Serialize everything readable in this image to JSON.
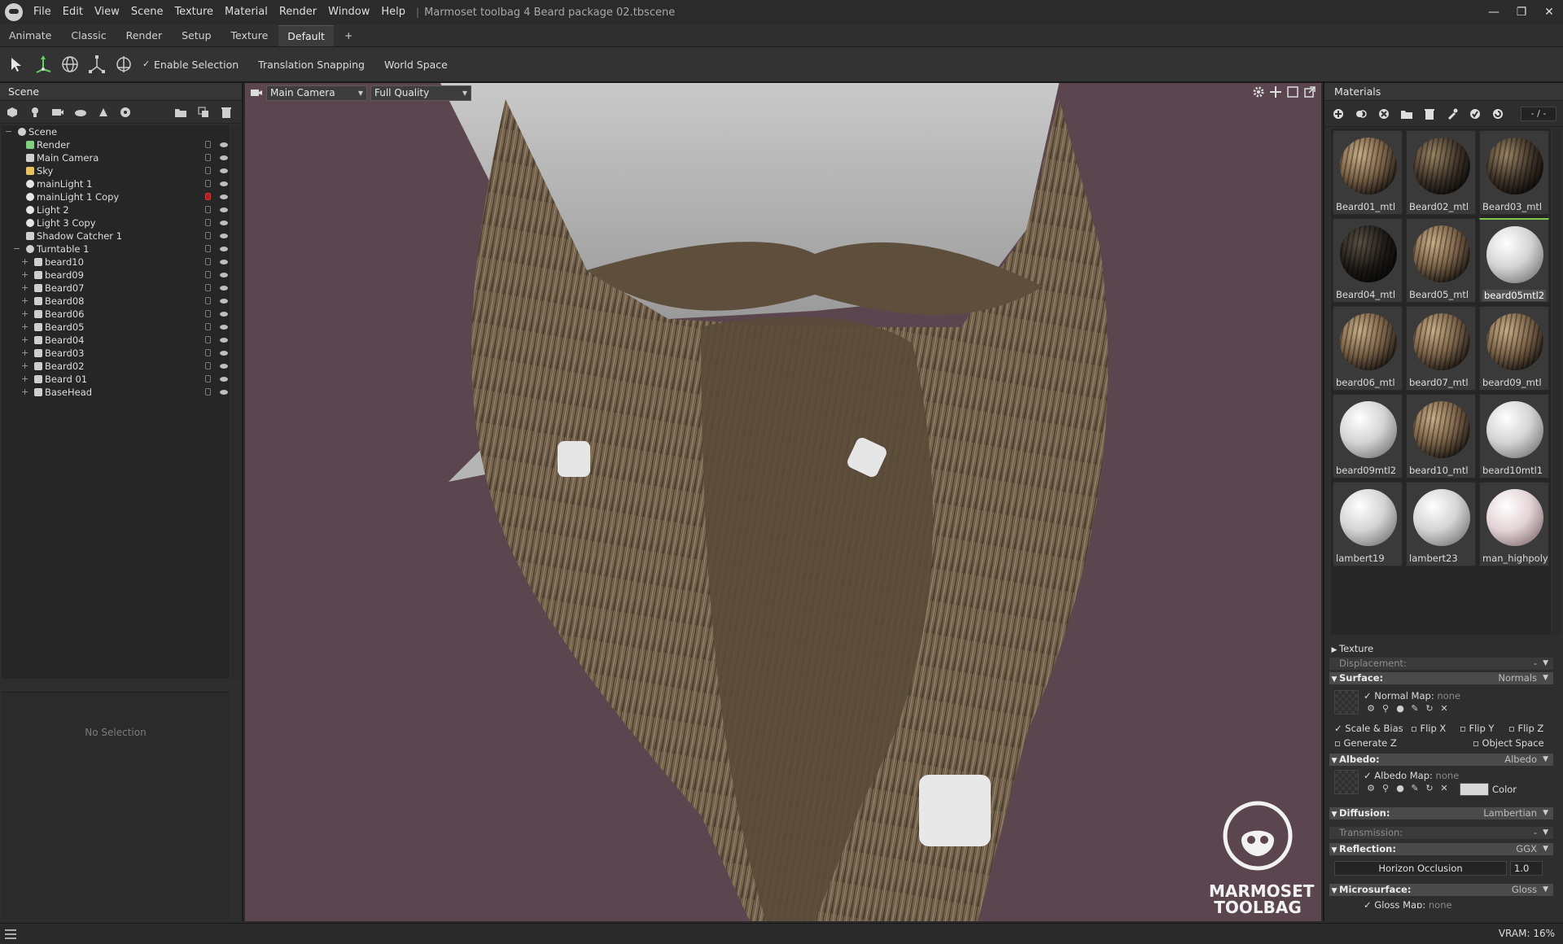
{
  "window": {
    "menu": [
      "File",
      "Edit",
      "View",
      "Scene",
      "Texture",
      "Material",
      "Render",
      "Window",
      "Help"
    ],
    "separator": "|",
    "title": "Marmoset toolbag 4 Beard package 02.tbscene",
    "minimize": "—",
    "maximize": "❐",
    "close": "✕"
  },
  "tabs": [
    "Animate",
    "Classic",
    "Render",
    "Setup",
    "Texture",
    "Default",
    "+"
  ],
  "toolbar": {
    "enable_selection": "Enable Selection",
    "translation_snapping": "Translation Snapping",
    "world_space": "World Space",
    "check": "✓"
  },
  "scene": {
    "title": "Scene",
    "no_selection": "No Selection",
    "tree": [
      {
        "label": "Scene",
        "depth": 0,
        "icon": "scene",
        "expand": "−"
      },
      {
        "label": "Render",
        "depth": 1,
        "icon": "render"
      },
      {
        "label": "Main Camera",
        "depth": 1,
        "icon": "camera"
      },
      {
        "label": "Sky",
        "depth": 1,
        "icon": "sky"
      },
      {
        "label": "mainLight 1",
        "depth": 1,
        "icon": "light"
      },
      {
        "label": "mainLight 1 Copy",
        "depth": 1,
        "icon": "light",
        "locked": true
      },
      {
        "label": "Light 2",
        "depth": 1,
        "icon": "light"
      },
      {
        "label": "Light 3 Copy",
        "depth": 1,
        "icon": "light"
      },
      {
        "label": "Shadow Catcher 1",
        "depth": 1,
        "icon": "shadow"
      },
      {
        "label": "Turntable 1",
        "depth": 1,
        "icon": "turntable",
        "expand": "−"
      },
      {
        "label": "beard10",
        "depth": 2,
        "icon": "mesh",
        "expand": "+"
      },
      {
        "label": "beard09",
        "depth": 2,
        "icon": "mesh",
        "expand": "+"
      },
      {
        "label": "Beard07",
        "depth": 2,
        "icon": "mesh",
        "expand": "+"
      },
      {
        "label": "Beard08",
        "depth": 2,
        "icon": "mesh",
        "expand": "+"
      },
      {
        "label": "Beard06",
        "depth": 2,
        "icon": "mesh",
        "expand": "+"
      },
      {
        "label": "Beard05",
        "depth": 2,
        "icon": "mesh",
        "expand": "+"
      },
      {
        "label": "Beard04",
        "depth": 2,
        "icon": "mesh",
        "expand": "+"
      },
      {
        "label": "Beard03",
        "depth": 2,
        "icon": "mesh",
        "expand": "+"
      },
      {
        "label": "Beard02",
        "depth": 2,
        "icon": "mesh",
        "expand": "+"
      },
      {
        "label": "Beard 01",
        "depth": 2,
        "icon": "mesh",
        "expand": "+"
      },
      {
        "label": "BaseHead",
        "depth": 2,
        "icon": "mesh",
        "expand": "+"
      }
    ]
  },
  "viewport": {
    "camera": "Main Camera",
    "quality": "Full Quality",
    "watermark_line1": "MARMOSET",
    "watermark_line2": "TOOLBAG",
    "background": "#5b4650"
  },
  "materials": {
    "title": "Materials",
    "count": "- / -",
    "items": [
      {
        "name": "Beard01_mtl",
        "kind": "hair"
      },
      {
        "name": "Beard02_mtl",
        "kind": "hair-dark"
      },
      {
        "name": "Beard03_mtl",
        "kind": "hair-dark"
      },
      {
        "name": "Beard04_mtl",
        "kind": "hair-black"
      },
      {
        "name": "Beard05_mtl",
        "kind": "hair"
      },
      {
        "name": "beard05mtl2",
        "kind": "white",
        "selected": true
      },
      {
        "name": "beard06_mtl",
        "kind": "hair"
      },
      {
        "name": "beard07_mtl",
        "kind": "hair"
      },
      {
        "name": "beard09_mtl",
        "kind": "hair"
      },
      {
        "name": "beard09mtl2",
        "kind": "white"
      },
      {
        "name": "beard10_mtl",
        "kind": "hair"
      },
      {
        "name": "beard10mtl1",
        "kind": "white"
      },
      {
        "name": "lambert19",
        "kind": "white"
      },
      {
        "name": "lambert23",
        "kind": "white"
      },
      {
        "name": "man_highpoly",
        "kind": "pink"
      }
    ]
  },
  "props": {
    "texture": "Texture",
    "displacement": "Displacement:",
    "displacement_value": "-",
    "surface": "Surface:",
    "surface_value": "Normals",
    "normal_map": "Normal Map:",
    "none": "none",
    "scale_bias": "Scale & Bias",
    "flip_x": "Flip X",
    "flip_y": "Flip Y",
    "flip_z": "Flip Z",
    "generate_z": "Generate Z",
    "object_space": "Object Space",
    "albedo": "Albedo:",
    "albedo_value": "Albedo",
    "albedo_map": "Albedo Map:",
    "color": "Color",
    "diffusion": "Diffusion:",
    "diffusion_value": "Lambertian",
    "transmission": "Transmission:",
    "transmission_value": "-",
    "reflection": "Reflection:",
    "reflection_value": "GGX",
    "horizon_occlusion": "Horizon Occlusion",
    "horizon_value": "1.0",
    "microsurface": "Microsurface:",
    "microsurface_value": "Gloss",
    "gloss_map": "Gloss Map:",
    "gloss_none": "none"
  },
  "status": {
    "vram": "VRAM: 16%"
  }
}
